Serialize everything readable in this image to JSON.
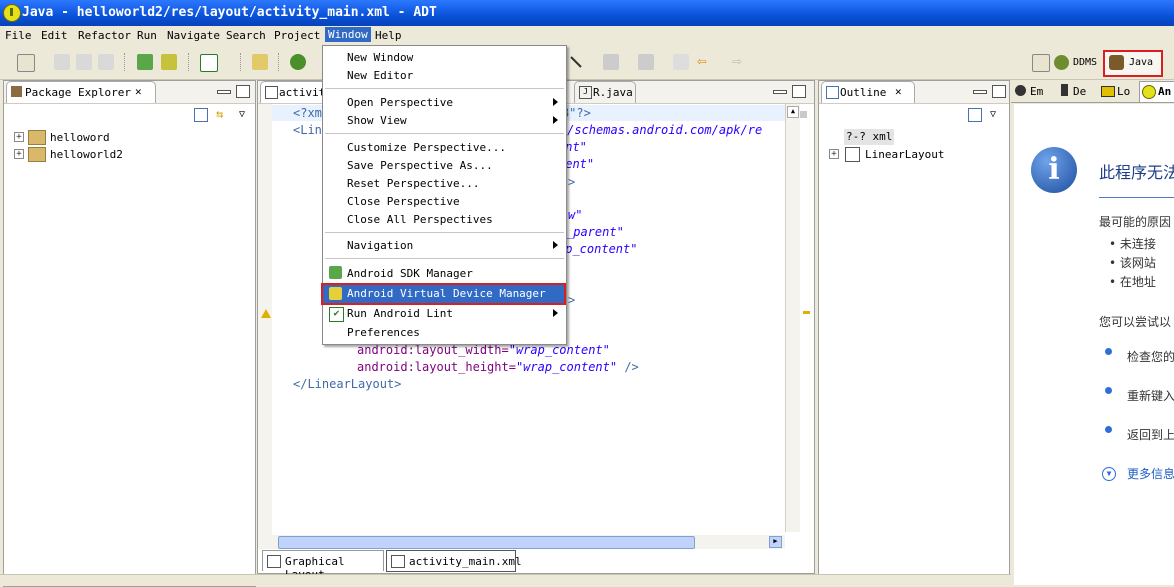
{
  "window": {
    "title": "Java - helloworld2/res/layout/activity_main.xml - ADT"
  },
  "menubar": [
    "File",
    "Edit",
    "Refactor",
    "Run",
    "Navigate",
    "Search",
    "Project",
    "Window",
    "Help"
  ],
  "perspectives": {
    "ddms": "DDMS",
    "java": "Java"
  },
  "package_explorer": {
    "title": "Package Explorer",
    "items": [
      "helloword",
      "helloworld2"
    ]
  },
  "editor": {
    "tabs": [
      "activit",
      "R.java"
    ],
    "code_lines": [
      {
        "indent": 0,
        "parts": [
          [
            "tag",
            "<?xm"
          ],
          [
            "tag",
            "8\"?>"
          ]
        ]
      },
      {
        "indent": 0,
        "parts": [
          [
            "tag",
            "<Lin"
          ],
          [
            "str",
            "//schemas.android.com/apk/re"
          ]
        ]
      },
      {
        "indent": 0,
        "parts": [
          [
            "str",
            "ent\""
          ]
        ]
      },
      {
        "indent": 0,
        "parts": [
          [
            "str",
            "rent\""
          ]
        ]
      },
      {
        "indent": 0,
        "parts": [
          [
            "tag",
            ">"
          ]
        ]
      },
      {
        "indent": 0,
        "parts": [
          [
            "str",
            "w\""
          ]
        ]
      },
      {
        "indent": 0,
        "parts": [
          [
            "str",
            "_parent\""
          ]
        ]
      },
      {
        "indent": 0,
        "parts": [
          [
            "str",
            "ap_content\""
          ]
        ]
      },
      {
        "indent": 0,
        "parts": [
          [
            "tag",
            ">"
          ]
        ]
      },
      {
        "indent": 0,
        "parts": [
          [
            "attr",
            "android:layout_width="
          ],
          [
            "str",
            "\"wrap_content\""
          ]
        ]
      },
      {
        "indent": 0,
        "parts": [
          [
            "attr",
            "android:layout_height="
          ],
          [
            "str",
            "\"wrap_content\""
          ],
          [
            "tag",
            " />"
          ]
        ]
      },
      {
        "indent": 0,
        "parts": [
          [
            "tag",
            "</LinearLayout>"
          ]
        ]
      }
    ],
    "bottom_tabs": [
      "Graphical Layout",
      "activity_main.xml"
    ]
  },
  "outline": {
    "title": "Outline",
    "items": [
      "?-? xml",
      "LinearLayout"
    ]
  },
  "right_tabs": [
    "Em",
    "De",
    "Lo",
    "An"
  ],
  "window_menu": {
    "items": [
      {
        "label": "New Window",
        "submenu": false
      },
      {
        "label": "New Editor",
        "submenu": false
      },
      {
        "label": "Open Perspective",
        "submenu": true
      },
      {
        "label": "Show View",
        "submenu": true
      },
      {
        "label": "Customize Perspective...",
        "submenu": false
      },
      {
        "label": "Save Perspective As...",
        "submenu": false
      },
      {
        "label": "Reset Perspective...",
        "submenu": false
      },
      {
        "label": "Close Perspective",
        "submenu": false
      },
      {
        "label": "Close All Perspectives",
        "submenu": false
      },
      {
        "label": "Navigation",
        "submenu": true
      },
      {
        "label": "Android SDK Manager",
        "submenu": false
      },
      {
        "label": "Android Virtual Device Manager",
        "submenu": false,
        "highlighted": true
      },
      {
        "label": "Run Android Lint",
        "submenu": true
      },
      {
        "label": "Preferences",
        "submenu": false
      }
    ]
  },
  "browser_error": {
    "heading": "此程序无法",
    "cause": "最可能的原因",
    "bullets_small": [
      "未连接",
      "该网站",
      "在地址"
    ],
    "try_text": "您可以尝试以",
    "actions": [
      "检查您的",
      "重新键入",
      "返回到上"
    ],
    "more": "更多信息"
  }
}
